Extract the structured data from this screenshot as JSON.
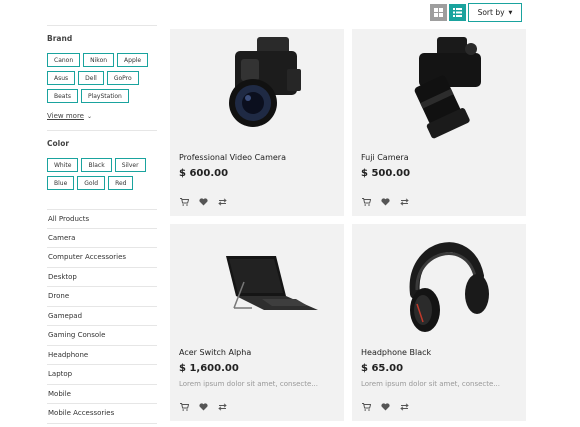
{
  "toolbar": {
    "sort_label": "Sort by",
    "grid_view_color": "#9e9e9e",
    "list_view_color": "#1aa39e"
  },
  "filters": {
    "brand_title": "Brand",
    "brands": [
      "Canon",
      "Nikon",
      "Apple",
      "Asus",
      "Dell",
      "GoPro",
      "Beats",
      "PlayStation"
    ],
    "view_more": "View more",
    "color_title": "Color",
    "colors": [
      "White",
      "Black",
      "Silver",
      "Blue",
      "Gold",
      "Red"
    ]
  },
  "categories": [
    "All Products",
    "Camera",
    "Computer Accessories",
    "Desktop",
    "Drone",
    "Gamepad",
    "Gaming Console",
    "Headphone",
    "Laptop",
    "Mobile",
    "Mobile Accessories"
  ],
  "products": [
    {
      "name": "Professional Video Camera",
      "price": "$ 600.00",
      "image_icon": "dslr-camera-icon"
    },
    {
      "name": "Fuji Camera",
      "price": "$ 500.00",
      "image_icon": "mirrorless-camera-icon"
    },
    {
      "name": "Acer Switch Alpha",
      "price": "$ 1,600.00",
      "description": "Lorem ipsum dolor sit amet, consecte...",
      "image_icon": "tablet-laptop-icon"
    },
    {
      "name": "Headphone Black",
      "price": "$ 65.00",
      "description": "Lorem ipsum dolor sit amet, consecte...",
      "image_icon": "headphones-icon"
    }
  ],
  "accent_color": "#1aa39e"
}
